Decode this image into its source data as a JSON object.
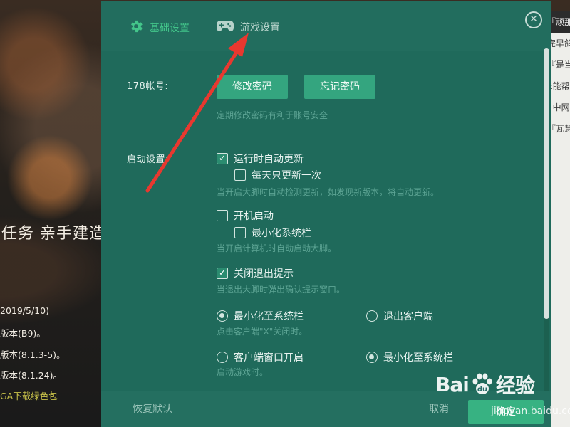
{
  "background": {
    "headline": "任务 亲手建造",
    "lines": [
      "2019/5/10)",
      "版本(B9)。",
      "版本(8.1.3-5)。",
      "版本(8.1.24)。",
      "GA下载绿色包"
    ],
    "right_column": [
      "『顽那",
      "完早鸽",
      "『是当",
      "E能帮",
      "1中网",
      "『瓦慧"
    ]
  },
  "dialog": {
    "tabs": [
      {
        "label": "基础设置",
        "icon": "gear-icon",
        "active": true
      },
      {
        "label": "游戏设置",
        "icon": "gamepad-icon",
        "active": false
      }
    ],
    "close_symbol": "✕",
    "account": {
      "label": "178帐号:",
      "change_password": "修改密码",
      "forgot_password": "忘记密码",
      "hint": "定期修改密码有利于账号安全"
    },
    "startup": {
      "label": "启动设置:",
      "auto_update": {
        "label": "运行时自动更新",
        "checked": true
      },
      "update_daily_once": {
        "label": "每天只更新一次",
        "checked": false
      },
      "update_hint": "当开启大脚时自动检测更新，如发现新版本，将自动更新。",
      "boot_start": {
        "label": "开机启动",
        "checked": false
      },
      "minimize_tray": {
        "label": "最小化系统栏",
        "checked": false
      },
      "boot_hint": "当开启计算机时自动启动大脚。",
      "exit_prompt": {
        "label": "关闭退出提示",
        "checked": true
      },
      "exit_hint": "当退出大脚时弹出确认提示窗口。",
      "close_action": {
        "options": [
          "最小化至系统栏",
          "退出客户端"
        ],
        "selected": 0,
        "hint": "点击客户端\"X\"关闭时。"
      },
      "game_launch": {
        "options": [
          "客户端窗口开启",
          "最小化至系统栏"
        ],
        "selected": 1,
        "hint": "启动游戏时。"
      }
    },
    "footer": {
      "restore_default": "恢复默认",
      "cancel": "取消",
      "ok": "确定"
    }
  },
  "watermark": {
    "brand_left": "Bai",
    "brand_right": "经验",
    "url": "jingyan.baidu.com"
  },
  "colors": {
    "dialog_bg": "#1f6a5b",
    "accent_green": "#43c58a",
    "button_green": "#34a57f",
    "annotation_arrow": "#e8382f"
  }
}
